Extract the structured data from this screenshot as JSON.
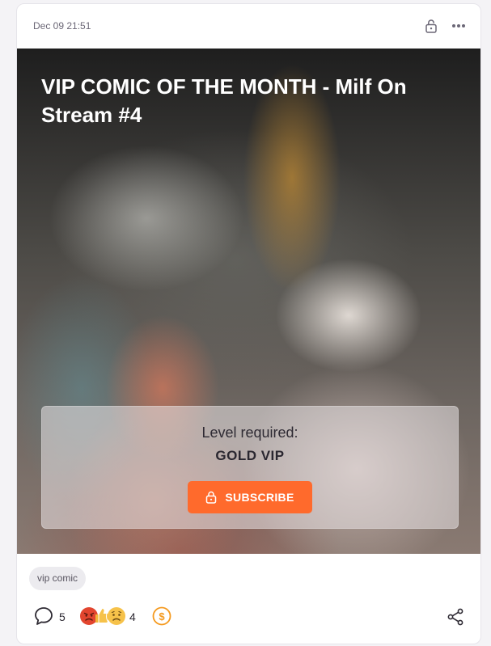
{
  "post": {
    "timestamp": "Dec 09 21:51",
    "title": "VIP COMIC OF THE MONTH - Milf On Stream #4",
    "locked_icon": "lock-icon",
    "menu_icon": "more-horizontal-icon"
  },
  "paywall": {
    "label": "Level required:",
    "level": "GOLD VIP",
    "button_label": "SUBSCRIBE",
    "button_icon": "lock-icon",
    "button_color": "#ff6a2c"
  },
  "tags": [
    "vip comic"
  ],
  "footer": {
    "comment_icon": "comment-icon",
    "comment_count": "5",
    "reaction_icons": [
      "angry-face-icon",
      "thumbs-up-icon",
      "sad-face-icon"
    ],
    "reaction_count": "4",
    "tip_icon": "dollar-coin-icon",
    "share_icon": "share-icon"
  },
  "colors": {
    "accent": "#ff6a2c",
    "text_primary": "#2e2a33",
    "text_muted": "#6b6776",
    "card_background": "#ffffff",
    "page_background": "#f4f3f6"
  }
}
